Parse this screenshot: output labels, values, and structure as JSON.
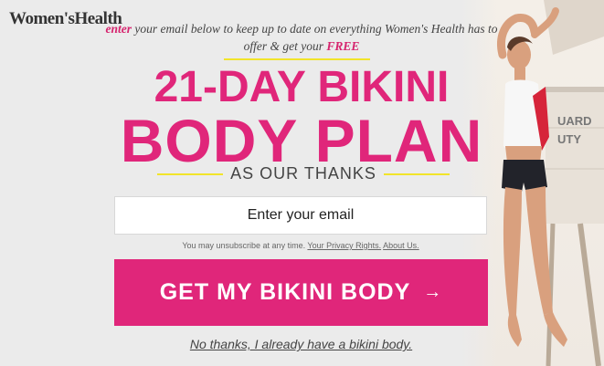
{
  "brand": {
    "logo": "Women'sHealth"
  },
  "intro": {
    "highlight_start": "enter",
    "text_middle": " your email below to keep up to date on everything Women's Health has to offer & get your ",
    "highlight_end": "FREE"
  },
  "headline": {
    "line1": "21-DAY BIKINI",
    "line2": "BODY PLAN",
    "subline": "AS OUR THANKS"
  },
  "form": {
    "email_placeholder": "Enter your email",
    "fine_print": "You may unsubscribe at any time.",
    "privacy_link": "Your Privacy Rights.",
    "about_link": "About Us.",
    "cta_label": "GET MY BIKINI BODY",
    "cta_arrow": "→",
    "decline_link": "No thanks, I already have a bikini body."
  },
  "photo": {
    "sign_text": [
      "UARD",
      "UTY"
    ]
  },
  "colors": {
    "accent": "#e0267a",
    "rule": "#f1e42a",
    "background": "#ebebeb"
  }
}
